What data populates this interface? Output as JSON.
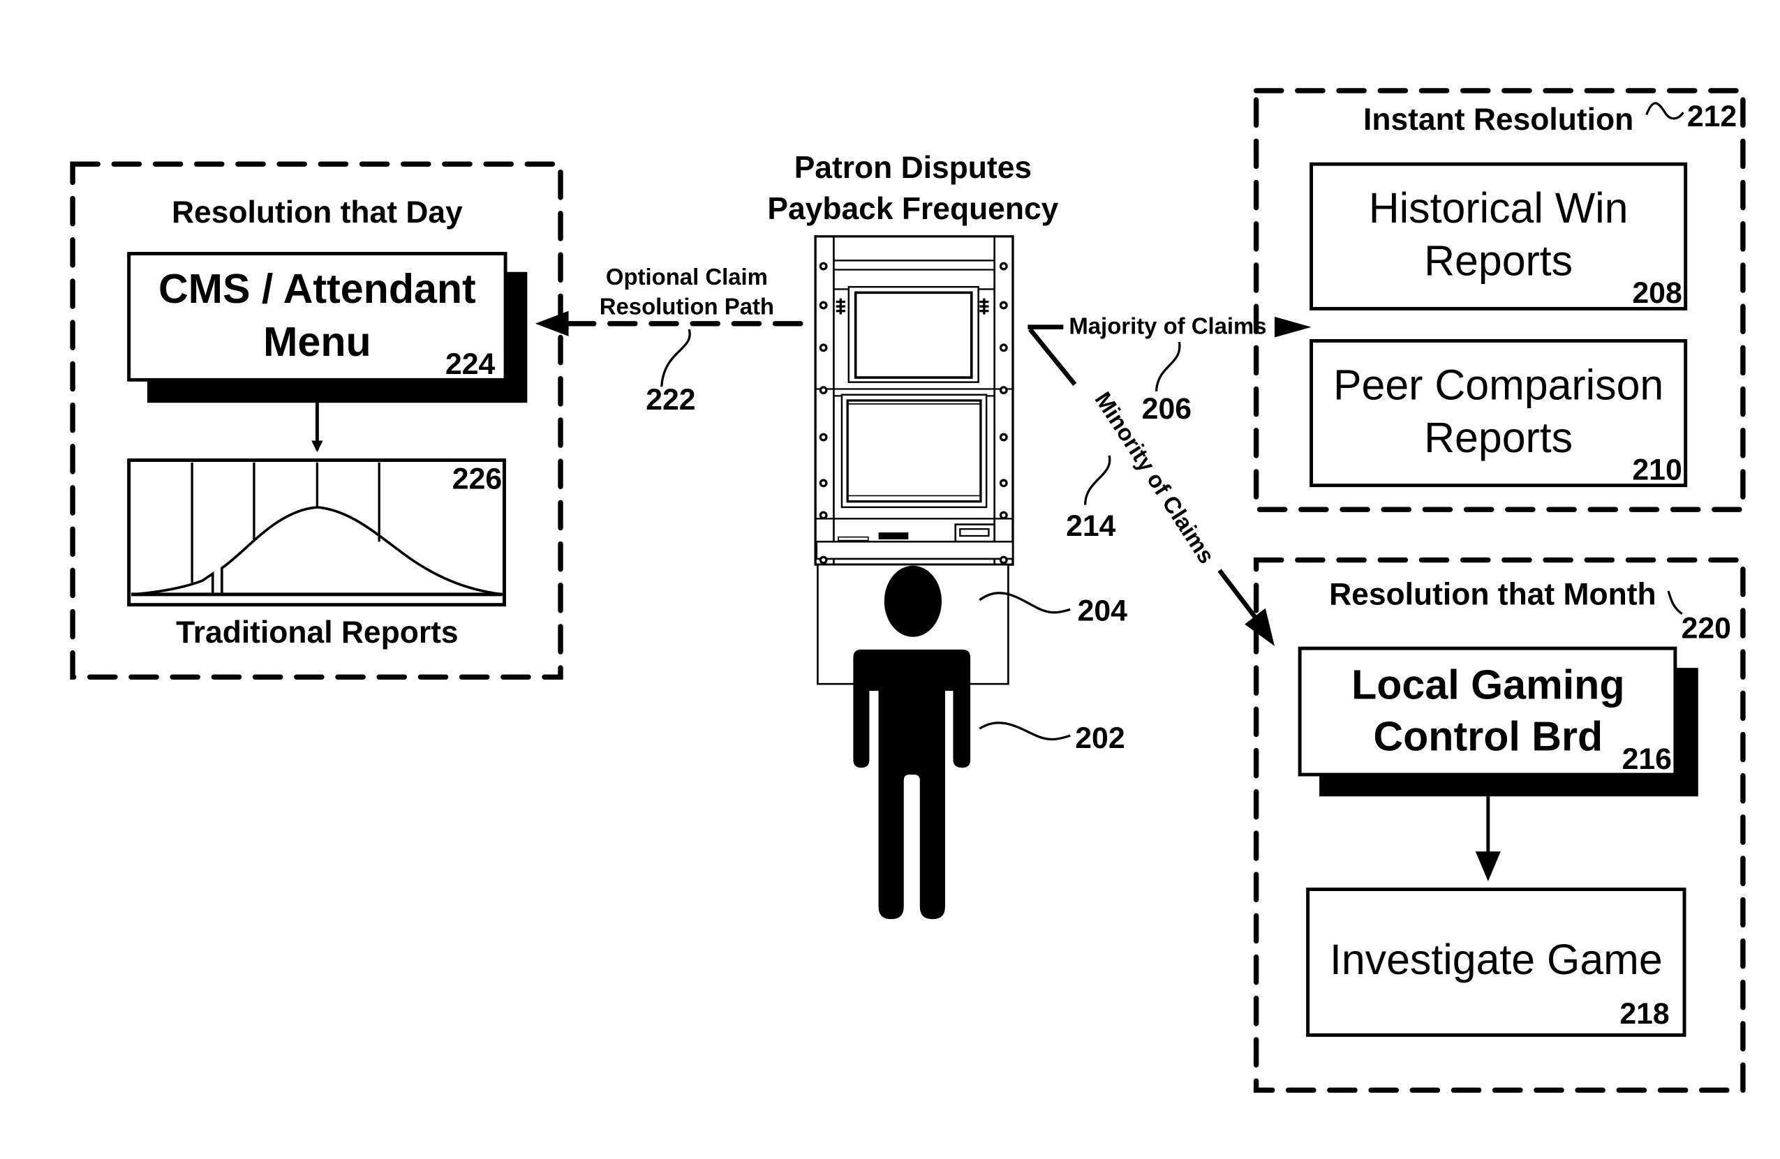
{
  "figure": {
    "center_title": [
      "Patron Disputes",
      "Payback Frequency"
    ],
    "paths": {
      "optional": {
        "label": [
          "Optional Claim",
          "Resolution Path"
        ],
        "ref": "222"
      },
      "majority": {
        "label": "Majority of Claims",
        "ref": "206"
      },
      "minority": {
        "label": "Minority of Claims",
        "ref": "214"
      }
    },
    "machine_ref": "204",
    "patron_ref": "202",
    "groups": {
      "day": {
        "title": "Resolution that Day",
        "cms_box": {
          "label": [
            "CMS / Attendant",
            "Menu"
          ],
          "ref": "224"
        },
        "report_box": {
          "caption": "Traditional Reports",
          "ref": "226"
        }
      },
      "instant": {
        "title": "Instant Resolution",
        "ref": "212",
        "boxes": [
          {
            "label": [
              "Historical Win",
              "Reports"
            ],
            "ref": "208"
          },
          {
            "label": [
              "Peer Comparison",
              "Reports"
            ],
            "ref": "210"
          }
        ]
      },
      "month": {
        "title": "Resolution that Month",
        "ref": "220",
        "boxes": [
          {
            "label": [
              "Local Gaming",
              "Control Brd"
            ],
            "ref": "216"
          },
          {
            "label": [
              "Investigate Game"
            ],
            "ref": "218"
          }
        ]
      }
    }
  }
}
